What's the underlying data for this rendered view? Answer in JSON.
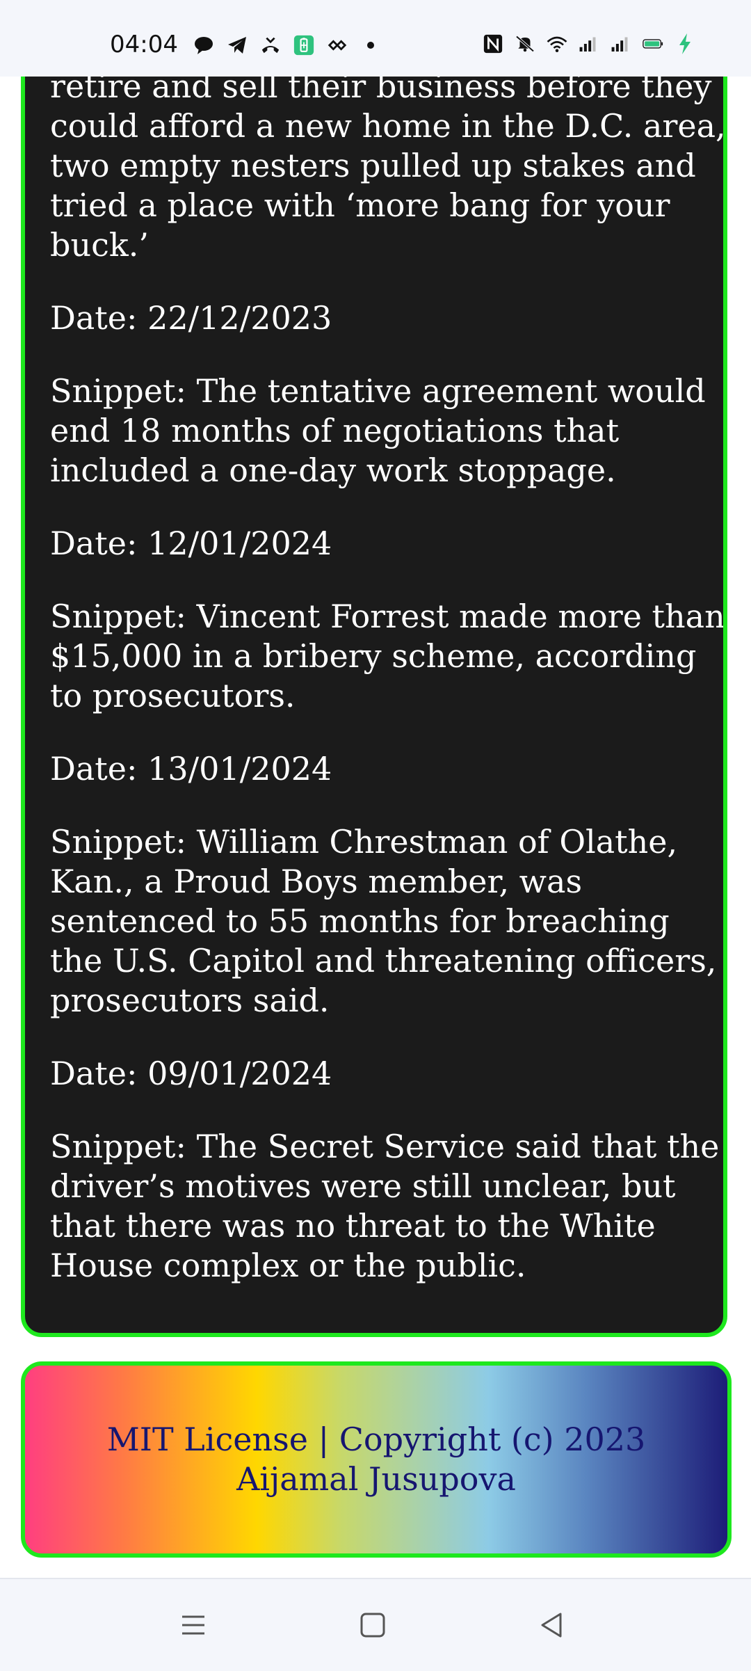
{
  "status_bar": {
    "time": "04:04",
    "icons_left": [
      "chat-bubble-icon",
      "telegram-icon",
      "missed-call-icon",
      "battery-saver-icon",
      "link-icon",
      "dot-icon"
    ],
    "icons_right": [
      "nfc-icon",
      "mute-icon",
      "wifi-icon",
      "signal-icon",
      "signal-icon-2",
      "battery-icon",
      "charging-icon"
    ]
  },
  "content": {
    "items": [
      {
        "text": "retire and sell their business before they could afford a new home in the D.C. area, two empty nesters pulled up stakes and tried a place with ‘more bang for your buck.’"
      },
      {
        "text": "Date: 22/12/2023"
      },
      {
        "text": "Snippet: The tentative agreement would end 18 months of negotiations that included a one-day work stoppage."
      },
      {
        "text": "Date: 12/01/2024"
      },
      {
        "text": "Snippet: Vincent Forrest made more than $15,000 in a bribery scheme, according to prosecutors."
      },
      {
        "text": "Date: 13/01/2024"
      },
      {
        "text": "Snippet: William Chrestman of Olathe, Kan., a Proud Boys member, was sentenced to 55 months for breaching the U.S. Capitol and threatening officers, prosecutors said."
      },
      {
        "text": "Date: 09/01/2024"
      },
      {
        "text": "Snippet: The Secret Service said that the driver’s motives were still unclear, but that there was no threat to the White House complex or the public."
      }
    ]
  },
  "footer": {
    "text": "MIT License | Copyright (c) 2023 Aijamal Jusupova"
  },
  "nav": {
    "menu": "menu-icon",
    "home": "home-icon",
    "back": "back-icon"
  },
  "colors": {
    "card_bg": "#1b1b1b",
    "border": "#1ee81e",
    "footer_text": "#161670"
  }
}
